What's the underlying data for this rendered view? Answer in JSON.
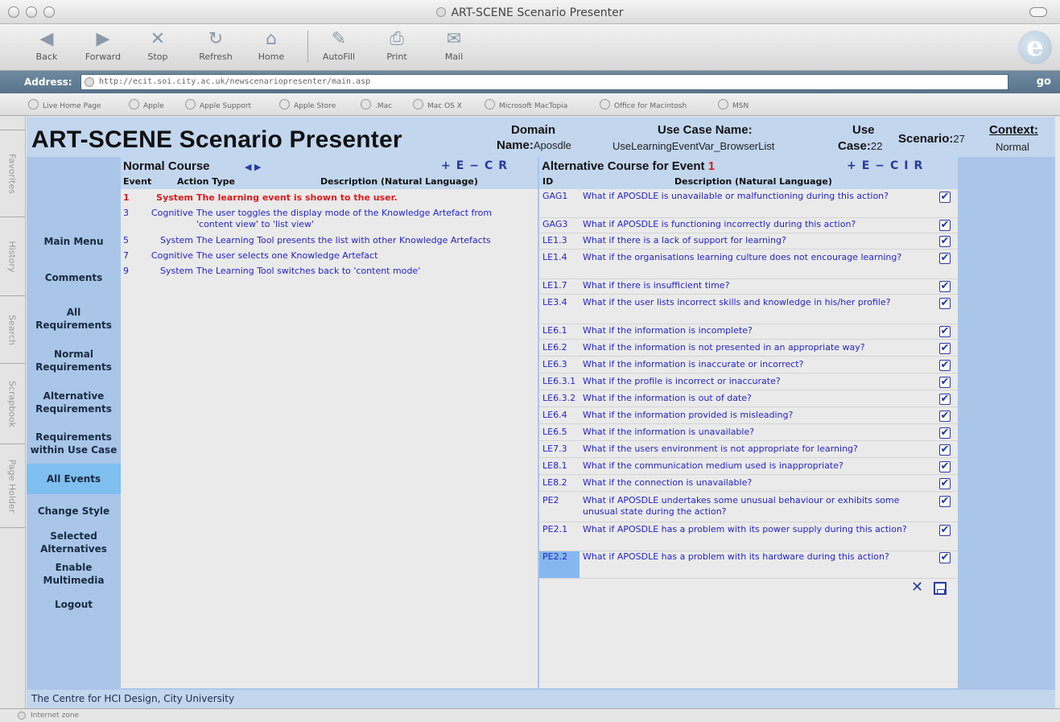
{
  "window": {
    "title": "ART-SCENE Scenario Presenter"
  },
  "toolbar": {
    "back": "Back",
    "forward": "Forward",
    "stop": "Stop",
    "refresh": "Refresh",
    "home": "Home",
    "autofill": "AutoFill",
    "print": "Print",
    "mail": "Mail"
  },
  "address": {
    "label": "Address:",
    "url": "http://ecit.soi.city.ac.uk/newscenariopresenter/main.asp",
    "go": "go"
  },
  "favorites": [
    "Live Home Page",
    "Apple",
    "Apple Support",
    "Apple Store",
    ".Mac",
    "Mac OS X",
    "Microsoft MacTopia",
    "Office for Macintosh",
    "MSN"
  ],
  "sidetabs": [
    "Favorites",
    "History",
    "Search",
    "Scrapbook",
    "Page Holder"
  ],
  "header": {
    "title": "ART-SCENE Scenario Presenter",
    "domain_label": "Domain",
    "name_label": "Name:",
    "domain_value": "Aposdle",
    "usecase_name_label": "Use Case Name:",
    "usecase_name_value": "UseLearningEventVar_BrowserList",
    "use_label": "Use",
    "case_label": "Case:",
    "case_value": "22",
    "scenario_label": "Scenario:",
    "scenario_value": "27",
    "context_label": "Context:",
    "context_value": "Normal"
  },
  "nav": [
    {
      "label": "Main Menu"
    },
    {
      "label": "Comments"
    },
    {
      "label": "All Requirements"
    },
    {
      "label": "Normal Requirements"
    },
    {
      "label": "Alternative Requirements"
    },
    {
      "label": "Requirements within Use Case"
    },
    {
      "label": "All Events"
    },
    {
      "label": "Change Style"
    },
    {
      "label": "Selected Alternatives"
    },
    {
      "label": "Enable Multimedia"
    },
    {
      "label": "Logout"
    }
  ],
  "normal": {
    "title": "Normal Course",
    "arrows": "◀ ▶",
    "controls": "+E−CR",
    "col_event": "Event",
    "col_action": "Action Type",
    "col_desc": "Description (Natural Language)",
    "rows": [
      {
        "event": "1",
        "action": "System",
        "desc": "The learning event is shown to the user."
      },
      {
        "event": "3",
        "action": "Cognitive",
        "desc": "The user toggles the display mode of the Knowledge Artefact from 'content view' to 'list view'"
      },
      {
        "event": "5",
        "action": "System",
        "desc": "The Learning Tool presents the list with other Knowledge Artefacts"
      },
      {
        "event": "7",
        "action": "Cognitive",
        "desc": "The user selects one Knowledge Artefact"
      },
      {
        "event": "9",
        "action": "System",
        "desc": "The Learning Tool switches back to 'content mode'"
      }
    ]
  },
  "alt": {
    "title": "Alternative Course for Event",
    "event": "1",
    "controls": "+E−CIR",
    "col_id": "ID",
    "col_desc": "Description (Natural Language)",
    "rows": [
      {
        "id": "GAG1",
        "desc": "What if APOSDLE is unavailable or malfunctioning during this action?"
      },
      {
        "id": "GAG3",
        "desc": "What if APOSDLE is functioning incorrectly during this action?"
      },
      {
        "id": "LE1.3",
        "desc": "What if there is a lack of support for learning?"
      },
      {
        "id": "LE1.4",
        "desc": "What if the organisations learning culture does not encourage learning?"
      },
      {
        "id": "LE1.7",
        "desc": "What if there is insufficient time?"
      },
      {
        "id": "LE3.4",
        "desc": "What if the user lists incorrect skills and knowledge in his/her profile?"
      },
      {
        "id": "LE6.1",
        "desc": "What if the information is incomplete?"
      },
      {
        "id": "LE6.2",
        "desc": "What if the information is not presented in an appropriate way?"
      },
      {
        "id": "LE6.3",
        "desc": "What if the information is inaccurate or incorrect?"
      },
      {
        "id": "LE6.3.1",
        "desc": "What if the profile is incorrect or inaccurate?"
      },
      {
        "id": "LE6.3.2",
        "desc": "What if the information is out of date?"
      },
      {
        "id": "LE6.4",
        "desc": "What if the information provided is misleading?"
      },
      {
        "id": "LE6.5",
        "desc": "What if the information is unavailable?"
      },
      {
        "id": "LE7.3",
        "desc": "What if the users environment is not appropriate for learning?"
      },
      {
        "id": "LE8.1",
        "desc": "What if the communication medium used is inappropriate?"
      },
      {
        "id": "LE8.2",
        "desc": "What if the connection is unavailable?"
      },
      {
        "id": "PE2",
        "desc": "What if APOSDLE undertakes some unusual behaviour or exhibits some unusual state during the action?"
      },
      {
        "id": "PE2.1",
        "desc": "What if APOSDLE has a problem with its power supply during this action?"
      },
      {
        "id": "PE2.2",
        "desc": "What if APOSDLE has a problem with its hardware during this action?"
      }
    ],
    "check_mark": "✔"
  },
  "footer": {
    "text": "The Centre for HCI Design, City University"
  },
  "status": {
    "text": "Internet zone"
  },
  "colors": {
    "accent": "#2424c8",
    "highlight_red": "#dd1a1a",
    "panel_blue": "#a9c6e9",
    "selected_blue": "#7fbff0"
  }
}
